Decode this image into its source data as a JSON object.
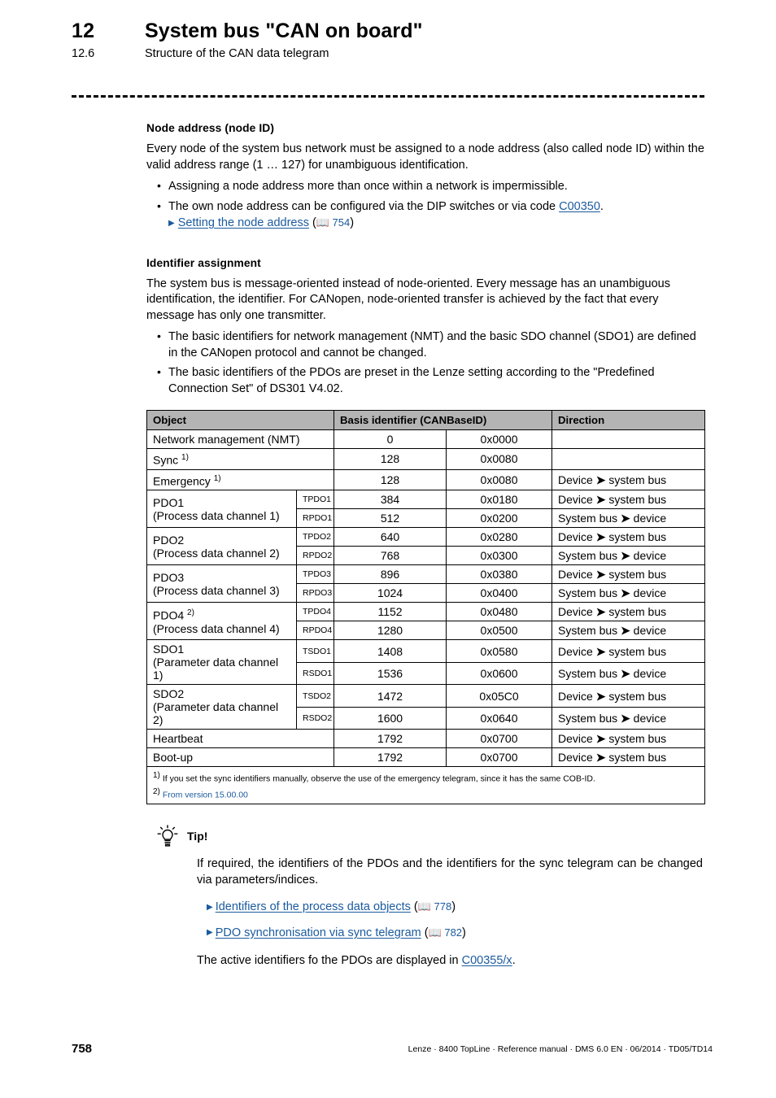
{
  "header": {
    "chapter_number": "12",
    "chapter_title": "System bus \"CAN on board\"",
    "section_number": "12.6",
    "section_title": "Structure of the CAN data telegram"
  },
  "sections": [
    {
      "heading": "Node address (node ID)",
      "paragraph": "Every node of the system bus network must be assigned to a node address (also called node ID) within the valid address range (1 … 127) for unambiguous identification.",
      "bullets": [
        "Assigning a node address more than once within a network is impermissible."
      ],
      "bullet2_pre": "The own node address can be configured via the DIP switches or via code ",
      "bullet2_code": "C00350",
      "bullet2_mid": ". ",
      "bullet2_link": "Setting the node address",
      "bullet2_page": "754"
    },
    {
      "heading": "Identifier assignment",
      "paragraph": "The system bus is message-oriented instead of node-oriented. Every message has an unambiguous identification, the identifier. For CANopen, node-oriented transfer is achieved by the fact that every message has only one transmitter.",
      "bullets": [
        "The basic identifiers for network management (NMT) and the basic SDO channel (SDO1) are defined in the CANopen protocol and cannot be changed.",
        "The basic identifiers of the PDOs are preset in the Lenze setting according to the \"Predefined Connection Set\" of DS301 V4.02."
      ]
    }
  ],
  "table": {
    "headers": {
      "object": "Object",
      "basis": "Basis identifier (CANBaseID)",
      "direction": "Direction"
    },
    "rows": [
      {
        "object": "Network management (NMT)",
        "object_sup": "",
        "object2": "",
        "sub": "",
        "dec": "0",
        "hex": "0x0000",
        "dir": "",
        "span_object": true
      },
      {
        "object": "Sync",
        "object_sup": "1)",
        "object2": "",
        "sub": "",
        "dec": "128",
        "hex": "0x0080",
        "dir": "",
        "span_object": true
      },
      {
        "object": "Emergency",
        "object_sup": "1)",
        "object2": "",
        "sub": "",
        "dec": "128",
        "hex": "0x0080",
        "dir": "Device ➜ system bus",
        "span_object": true
      },
      {
        "object": "PDO1",
        "object_sup": "",
        "object2": "(Process data channel 1)",
        "sub": "TPDO1",
        "dec": "384",
        "hex": "0x0180",
        "dir": "Device ➜ system bus",
        "rowspan": 2
      },
      {
        "sub": "RPDO1",
        "dec": "512",
        "hex": "0x0200",
        "dir": "System bus ➜ device",
        "continued": true
      },
      {
        "object": "PDO2",
        "object_sup": "",
        "object2": "(Process data channel 2)",
        "sub": "TPDO2",
        "dec": "640",
        "hex": "0x0280",
        "dir": "Device ➜ system bus",
        "rowspan": 2
      },
      {
        "sub": "RPDO2",
        "dec": "768",
        "hex": "0x0300",
        "dir": "System bus ➜ device",
        "continued": true
      },
      {
        "object": "PDO3",
        "object_sup": "",
        "object2": "(Process data channel 3)",
        "sub": "TPDO3",
        "dec": "896",
        "hex": "0x0380",
        "dir": "Device ➜ system bus",
        "rowspan": 2
      },
      {
        "sub": "RPDO3",
        "dec": "1024",
        "hex": "0x0400",
        "dir": "System bus ➜ device",
        "continued": true
      },
      {
        "object": "PDO4",
        "object_sup": "2)",
        "object2": "(Process data channel 4)",
        "sub": "TPDO4",
        "dec": "1152",
        "hex": "0x0480",
        "dir": "Device ➜ system bus",
        "rowspan": 2
      },
      {
        "sub": "RPDO4",
        "dec": "1280",
        "hex": "0x0500",
        "dir": "System bus ➜ device",
        "continued": true
      },
      {
        "object": "SDO1",
        "object_sup": "",
        "object2": "(Parameter data channel 1)",
        "sub": "TSDO1",
        "dec": "1408",
        "hex": "0x0580",
        "dir": "Device ➜ system bus",
        "rowspan": 2
      },
      {
        "sub": "RSDO1",
        "dec": "1536",
        "hex": "0x0600",
        "dir": "System bus ➜ device",
        "continued": true
      },
      {
        "object": "SDO2",
        "object_sup": "",
        "object2": "(Parameter data channel 2)",
        "sub": "TSDO2",
        "dec": "1472",
        "hex": "0x05C0",
        "dir": "Device ➜ system bus",
        "rowspan": 2
      },
      {
        "sub": "RSDO2",
        "dec": "1600",
        "hex": "0x0640",
        "dir": "System bus ➜ device",
        "continued": true
      },
      {
        "object": "Heartbeat",
        "object_sup": "",
        "object2": "",
        "sub": "",
        "dec": "1792",
        "hex": "0x0700",
        "dir": "Device ➜ system bus",
        "span_object": true
      },
      {
        "object": "Boot-up",
        "object_sup": "",
        "object2": "",
        "sub": "",
        "dec": "1792",
        "hex": "0x0700",
        "dir": "Device ➜ system bus",
        "span_object": true
      }
    ],
    "footnotes": {
      "fn1_marker": "1)",
      "fn1_text": "If you set the sync identifiers manually, observe the use of the emergency telegram, since it has the same COB-ID.",
      "fn2_marker": "2)",
      "fn2_text": "From version 15.00.00"
    }
  },
  "tip": {
    "label": "Tip!",
    "paragraph": "If required, the identifiers of the PDOs and the identifiers for the sync telegram can be changed via parameters/indices.",
    "links": [
      {
        "text": "Identifiers of the process data objects",
        "page": "778"
      },
      {
        "text": "PDO synchronisation via sync telegram",
        "page": "782"
      }
    ],
    "closing_pre": "The active identifiers fo the PDOs are displayed in ",
    "closing_code": "C00355/x",
    "closing_post": "."
  },
  "footer": {
    "page_number": "758",
    "text": "Lenze · 8400 TopLine · Reference manual · DMS 6.0 EN · 06/2014 · TD05/TD14"
  },
  "colors": {
    "link": "#1a5a9e",
    "table_header_bg": "#b4b4b4"
  }
}
